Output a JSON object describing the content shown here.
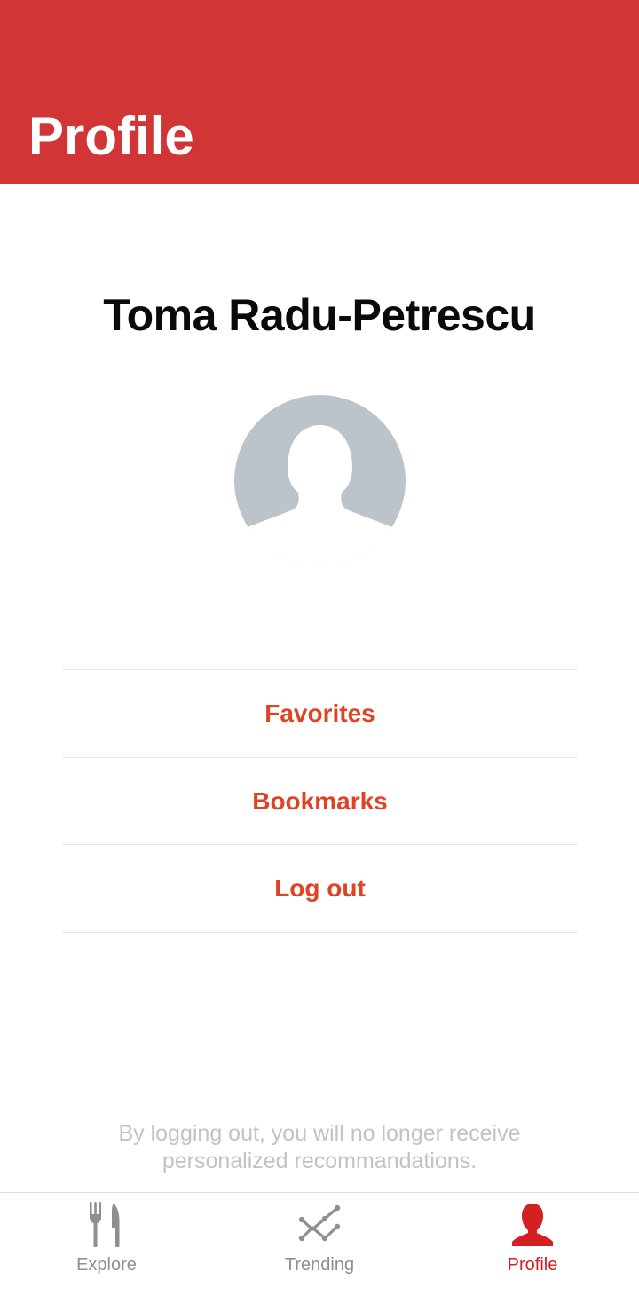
{
  "header": {
    "title": "Profile"
  },
  "profile": {
    "name": "Toma Radu-Petrescu"
  },
  "menu": {
    "items": [
      {
        "label": "Favorites"
      },
      {
        "label": "Bookmarks"
      },
      {
        "label": "Log out"
      }
    ]
  },
  "note": "By logging out, you will no longer receive personalized recommandations.",
  "tabs": [
    {
      "label": "Explore",
      "icon": "fork-knife-icon",
      "active": false
    },
    {
      "label": "Trending",
      "icon": "trending-icon",
      "active": false
    },
    {
      "label": "Profile",
      "icon": "person-icon",
      "active": true
    }
  ],
  "colors": {
    "header": "#d13535",
    "accent": "#de4326",
    "active_tab": "#d42020",
    "inactive_tab": "#8e8e93",
    "avatar": "#bdc3cb"
  }
}
